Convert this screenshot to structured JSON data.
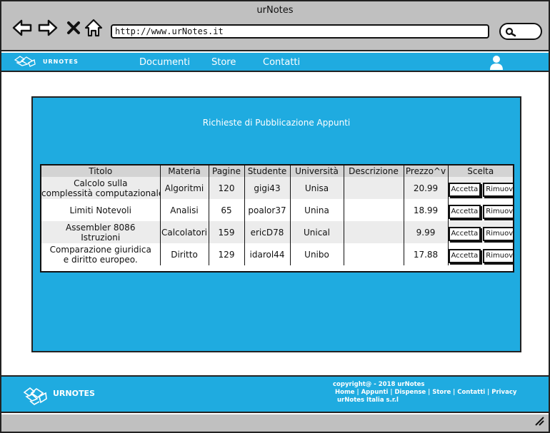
{
  "window": {
    "title": "urNotes"
  },
  "browser": {
    "url": "http://www.urNotes.it",
    "icons": [
      "back-arrow-icon",
      "forward-arrow-icon",
      "close-x-icon",
      "home-icon",
      "search-icon"
    ]
  },
  "navbar": {
    "brand": "URNOTES",
    "links": [
      "Documenti",
      "Store",
      "Contatti"
    ],
    "user_icon": "user-icon"
  },
  "main": {
    "title": "Richieste di Pubblicazione Appunti",
    "table": {
      "headers": [
        "Titolo",
        "Materia",
        "Pagine",
        "Studente",
        "Università",
        "Descrizione",
        "Prezzo^v",
        "Scelta"
      ],
      "rows": [
        {
          "titolo_line1": "Calcolo sulla",
          "titolo_line2": "complessità computazionale",
          "materia": "Algoritmi",
          "pagine": "120",
          "studente": "gigi43",
          "universita": "Unisa",
          "descrizione": "",
          "prezzo": "20.99",
          "accept": "Accetta",
          "remove": "Rimuovi"
        },
        {
          "titolo_line1": "Limiti Notevoli",
          "titolo_line2": "",
          "materia": "Analisi",
          "pagine": "65",
          "studente": "poalor37",
          "universita": "Unina",
          "descrizione": "",
          "prezzo": "18.99",
          "accept": "Accetta",
          "remove": "Rimuovi"
        },
        {
          "titolo_line1": "Assembler 8086",
          "titolo_line2": "Istruzioni",
          "materia": "Calcolatori",
          "pagine": "159",
          "studente": "ericD78",
          "universita": "Unical",
          "descrizione": "",
          "prezzo": "9.99",
          "accept": "Accetta",
          "remove": "Rimuovi"
        },
        {
          "titolo_line1": "Comparazione giuridica",
          "titolo_line2": "e diritto europeo.",
          "materia": "Diritto",
          "pagine": "129",
          "studente": "idarol44",
          "universita": "Unibo",
          "descrizione": "",
          "prezzo": "17.88",
          "accept": "Accetta",
          "remove": "Rimuovi"
        }
      ]
    }
  },
  "footer": {
    "brand": "URNOTES",
    "copyright": "copyright@ - 2018 urNotes",
    "links": "Home | Appunti | Dispense | Store | Contatti | Privacy",
    "company": "urNotes Italia s.r.l"
  },
  "colors": {
    "accent": "#1fabe0",
    "chrome": "#c0c0c0",
    "header_row": "#d3d3d3"
  }
}
